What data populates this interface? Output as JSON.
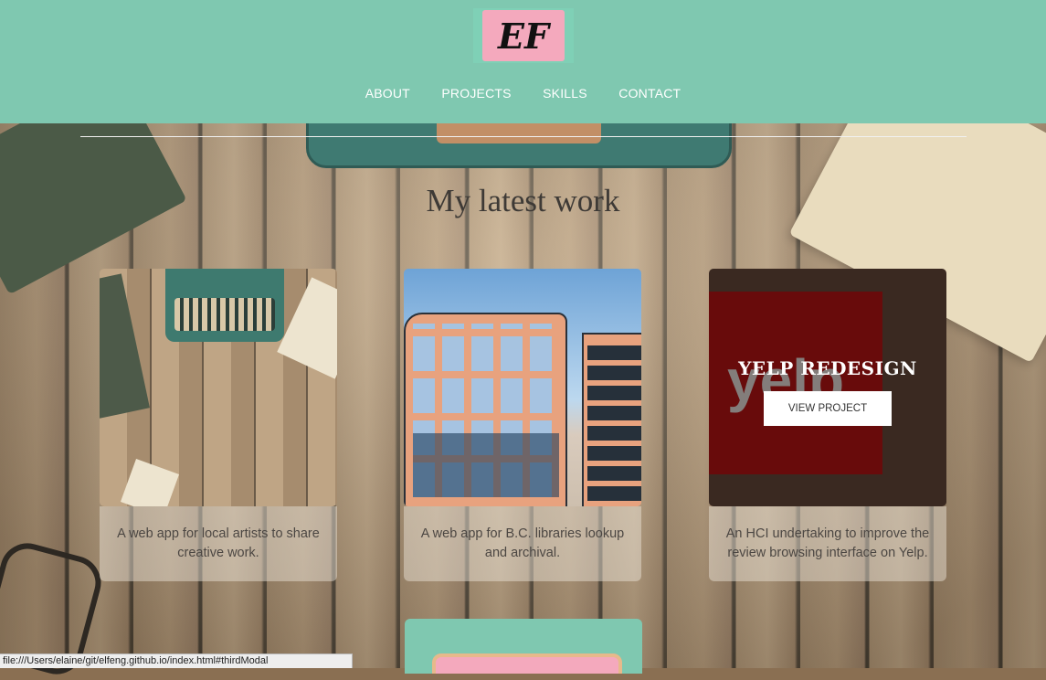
{
  "header": {
    "logo_text": "EF",
    "nav": [
      {
        "label": "ABOUT"
      },
      {
        "label": "PROJECTS"
      },
      {
        "label": "SKILLS"
      },
      {
        "label": "CONTACT"
      }
    ]
  },
  "section": {
    "title": "My latest work"
  },
  "projects": [
    {
      "description": "A web app for local artists to share creative work."
    },
    {
      "description": "A web app for B.C. libraries lookup and archival."
    },
    {
      "title": "YELP REDESIGN",
      "button_label": "VIEW PROJECT",
      "description": "An HCI undertaking to improve the review browsing interface on Yelp."
    }
  ],
  "status_bar": {
    "url": "file:///Users/elaine/git/elfeng.github.io/index.html#thirdModal"
  },
  "colors": {
    "header_bg": "#7fc8b0",
    "logo_pink": "#f4a9bd",
    "yelp_red": "#a01212"
  },
  "icons": [
    "logo-icon"
  ]
}
